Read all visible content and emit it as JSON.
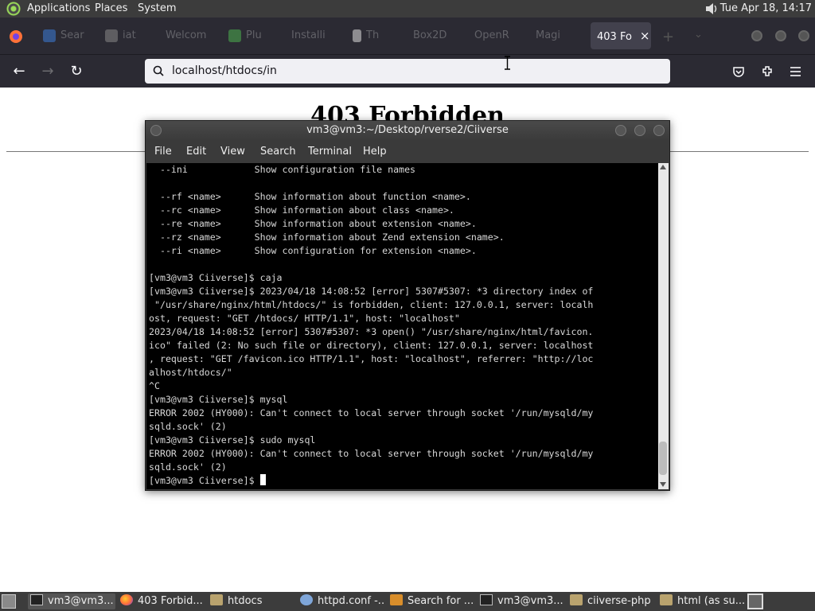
{
  "top_panel": {
    "menus": [
      "Applications",
      "Places",
      "System"
    ],
    "clock": "Tue Apr 18, 14:17"
  },
  "browser": {
    "tabs": [
      {
        "label": "Sear",
        "icon": "globe-icon"
      },
      {
        "label": "iat",
        "icon": "doc-icon"
      },
      {
        "label": "Welcom",
        "icon": "none"
      },
      {
        "label": "Plu",
        "icon": "plugin-icon"
      },
      {
        "label": "Installi",
        "icon": "none"
      },
      {
        "label": "Th",
        "icon": "page-icon"
      },
      {
        "label": "Box2D",
        "icon": "none"
      },
      {
        "label": "OpenR",
        "icon": "none"
      },
      {
        "label": "Magi",
        "icon": "none"
      }
    ],
    "active_tab": "403 Fo",
    "url": "localhost/htdocs/in"
  },
  "page": {
    "heading": "403 Forbidden"
  },
  "terminal": {
    "title": "vm3@vm3:~/Desktop/rverse2/Ciiverse",
    "menu": [
      "File",
      "Edit",
      "View",
      "Search",
      "Terminal",
      "Help"
    ],
    "lines": [
      "  --ini            Show configuration file names",
      "",
      "  --rf <name>      Show information about function <name>.",
      "  --rc <name>      Show information about class <name>.",
      "  --re <name>      Show information about extension <name>.",
      "  --rz <name>      Show information about Zend extension <name>.",
      "  --ri <name>      Show configuration for extension <name>.",
      "",
      "[vm3@vm3 Ciiverse]$ caja",
      "[vm3@vm3 Ciiverse]$ 2023/04/18 14:08:52 [error] 5307#5307: *3 directory index of",
      " \"/usr/share/nginx/html/htdocs/\" is forbidden, client: 127.0.0.1, server: localh",
      "ost, request: \"GET /htdocs/ HTTP/1.1\", host: \"localhost\"",
      "2023/04/18 14:08:52 [error] 5307#5307: *3 open() \"/usr/share/nginx/html/favicon.",
      "ico\" failed (2: No such file or directory), client: 127.0.0.1, server: localhost",
      ", request: \"GET /favicon.ico HTTP/1.1\", host: \"localhost\", referrer: \"http://loc",
      "alhost/htdocs/\"",
      "^C",
      "[vm3@vm3 Ciiverse]$ mysql",
      "ERROR 2002 (HY000): Can't connect to local server through socket '/run/mysqld/my",
      "sqld.sock' (2)",
      "[vm3@vm3 Ciiverse]$ sudo mysql",
      "ERROR 2002 (HY000): Can't connect to local server through socket '/run/mysqld/my",
      "sqld.sock' (2)"
    ],
    "prompt": "[vm3@vm3 Ciiverse]$ "
  },
  "taskbar": {
    "items": [
      {
        "label": "vm3@vm3...",
        "icon": "terminal-icon"
      },
      {
        "label": "403 Forbid...",
        "icon": "firefox-icon"
      },
      {
        "label": "htdocs",
        "icon": "folder-icon"
      },
      {
        "label": "httpd.conf -...",
        "icon": "text-editor-icon"
      },
      {
        "label": "Search for ...",
        "icon": "search-icon"
      },
      {
        "label": "vm3@vm3...",
        "icon": "terminal-icon"
      },
      {
        "label": "ciiverse-php",
        "icon": "folder-icon"
      },
      {
        "label": "html (as su...",
        "icon": "folder-icon"
      }
    ]
  }
}
